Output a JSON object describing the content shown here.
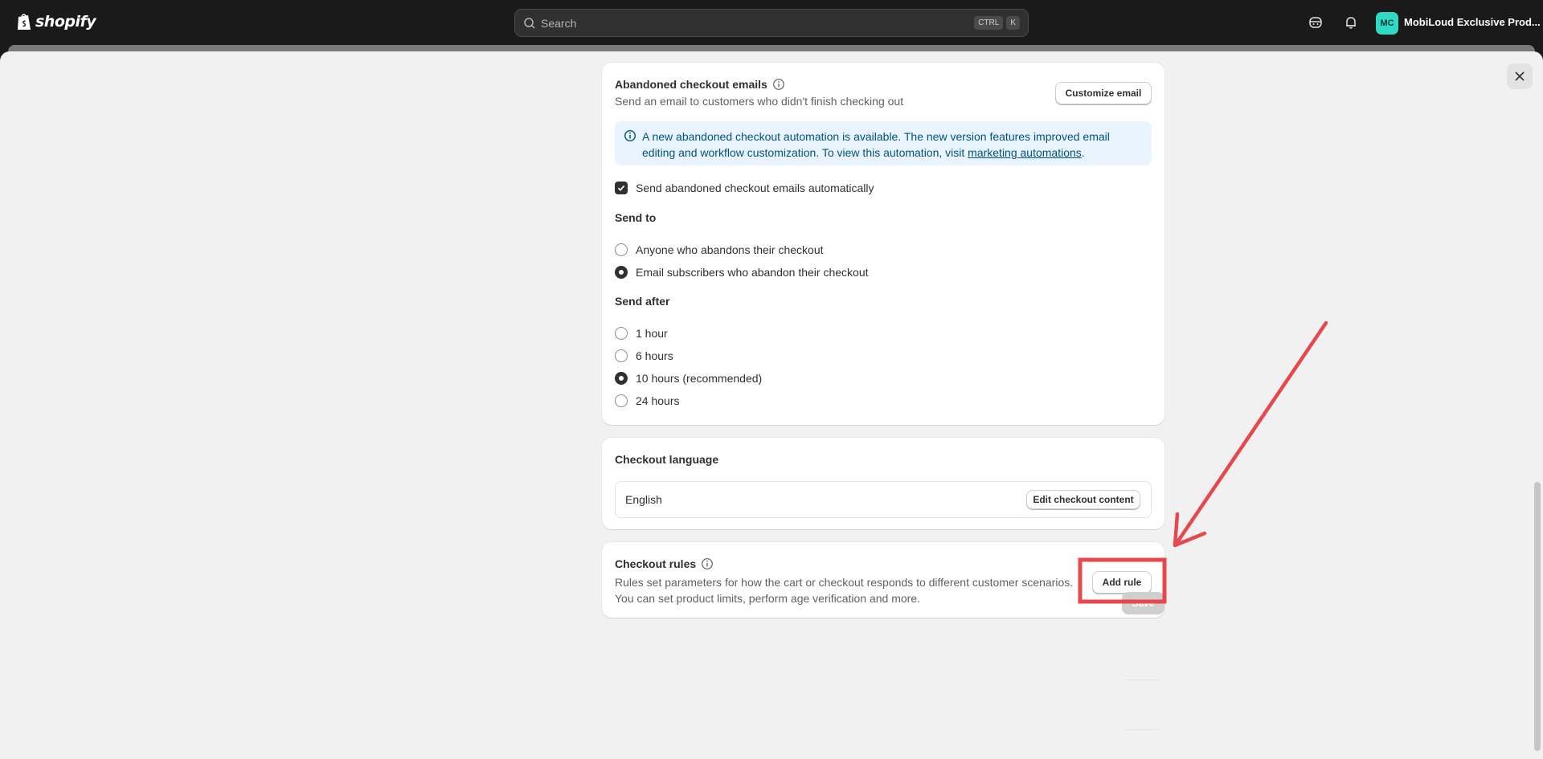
{
  "topbar": {
    "brand": "shopify",
    "search_placeholder": "Search",
    "shortcut_keys": [
      "CTRL",
      "K"
    ],
    "avatar_initials": "MC",
    "store_name": "MobiLoud Exclusive Prod..."
  },
  "abandoned": {
    "title": "Abandoned checkout emails",
    "description": "Send an email to customers who didn't finish checking out",
    "customize_button": "Customize email",
    "banner_text": "A new abandoned checkout automation is available. The new version features improved email editing and workflow customization. To view this automation, visit ",
    "banner_link": "marketing automations",
    "banner_end": ".",
    "auto_checkbox": "Send abandoned checkout emails automatically",
    "auto_checked": true,
    "send_to_label": "Send to",
    "send_to_options": [
      {
        "label": "Anyone who abandons their checkout",
        "selected": false
      },
      {
        "label": "Email subscribers who abandon their checkout",
        "selected": true
      }
    ],
    "send_after_label": "Send after",
    "send_after_options": [
      {
        "label": "1 hour",
        "selected": false
      },
      {
        "label": "6 hours",
        "selected": false
      },
      {
        "label": "10 hours (recommended)",
        "selected": true
      },
      {
        "label": "24 hours",
        "selected": false
      }
    ]
  },
  "language": {
    "title": "Checkout language",
    "value": "English",
    "edit_button": "Edit checkout content"
  },
  "rules": {
    "title": "Checkout rules",
    "description_line1": "Rules set parameters for how the cart or checkout responds to different customer scenarios.",
    "description_line2": "You can set product limits, perform age verification and more.",
    "add_button": "Add rule"
  },
  "footer": {
    "save_label": "Save"
  },
  "colors": {
    "annotation_red": "#e5484d",
    "banner_bg": "#eaf4ff",
    "avatar_bg": "#2fd9c4"
  }
}
